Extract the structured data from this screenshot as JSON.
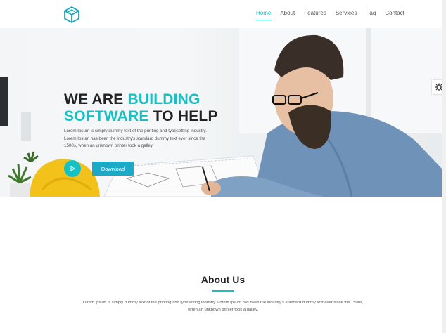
{
  "header": {
    "nav": [
      {
        "label": "Home",
        "active": true
      },
      {
        "label": "About"
      },
      {
        "label": "Features"
      },
      {
        "label": "Services"
      },
      {
        "label": "Faq"
      },
      {
        "label": "Contact"
      }
    ]
  },
  "hero": {
    "title_line1_plain": "WE ARE ",
    "title_line1_accent": "BUILDING",
    "title_line2_accent": "SOFTWARE",
    "title_line2_plain": " TO HELP",
    "description": "Lorem Ipsum is simply dummy text of the printing and typesetting industry. Lorem Ipsum has been the industry's standard dummy text ever since the 1500s, when an unknown printer took a galley.",
    "download_label": "Download"
  },
  "about": {
    "title": "About Us",
    "text": "Lorem Ipsum is simply dummy text of the printing and typesetting industry. Lorem Ipsum has been the industry's standard dummy text ever since the 1500s, when an unknown printer took a galley."
  },
  "colors": {
    "accent": "#16c1c4",
    "button": "#1aa9c6"
  }
}
